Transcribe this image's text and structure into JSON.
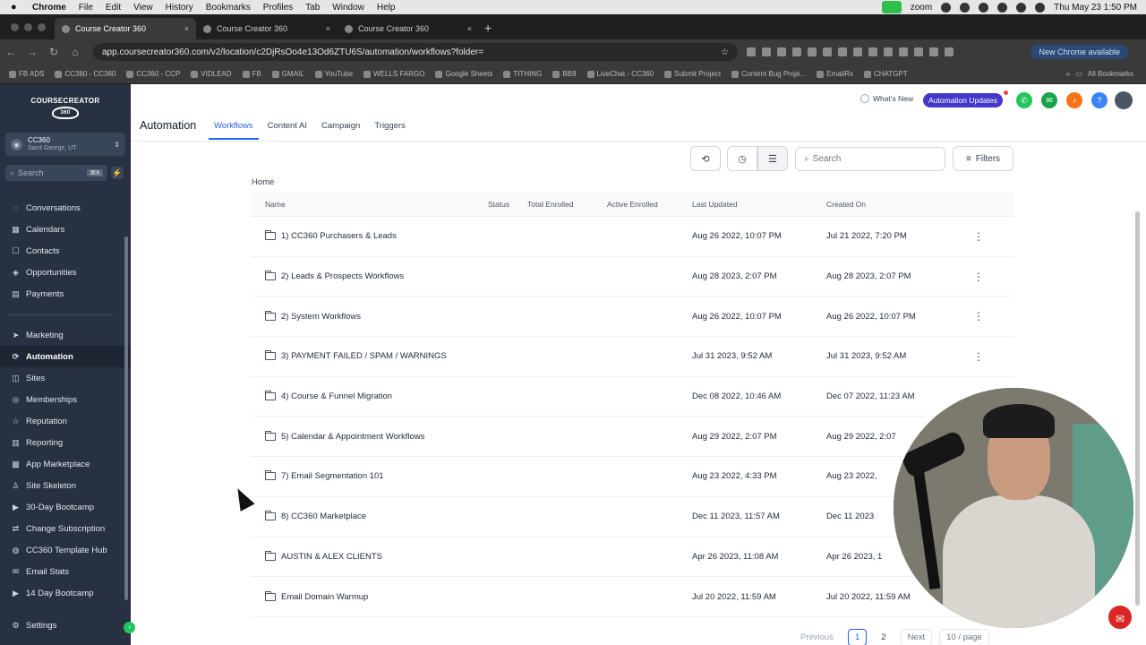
{
  "menubar": {
    "app": "Chrome",
    "items": [
      "File",
      "Edit",
      "View",
      "History",
      "Bookmarks",
      "Profiles",
      "Tab",
      "Window",
      "Help"
    ],
    "zoom": "zoom",
    "datetime": "Thu May 23  1:50 PM"
  },
  "browser": {
    "tabs": [
      {
        "label": "Course Creator 360",
        "close": "×"
      },
      {
        "label": "Course Creator 360",
        "close": "×"
      },
      {
        "label": "Course Creator 360",
        "close": "×"
      }
    ],
    "new_tab": "+",
    "url": "app.coursecreator360.com/v2/location/c2DjRsOo4e13Od6ZTU6S/automation/workflows?folder=",
    "new_chrome": "New Chrome available",
    "bookmarks": [
      "FB ADS",
      "CC360 - CC360",
      "CC360 - CCP",
      "VIDLEAD",
      "FB",
      "GMAIL",
      "YouTube",
      "WELLS FARGO",
      "Google Sheets",
      "TITHING",
      "BB9",
      "LiveChat - CC360",
      "Submit Project",
      "Content Bug Proje...",
      "EmailRx",
      "CHATGPT"
    ],
    "all_bookmarks": "All Bookmarks"
  },
  "sidebar": {
    "logo_text": "COURSECREATOR",
    "logo_mark": "360",
    "account_name": "CC360",
    "account_location": "Saint George, UT",
    "search_placeholder": "Search",
    "search_shortcut": "⌘K",
    "items_top": [
      {
        "label": "Conversations",
        "icon": "chat-icon"
      },
      {
        "label": "Calendars",
        "icon": "calendar-icon"
      },
      {
        "label": "Contacts",
        "icon": "contacts-icon"
      },
      {
        "label": "Opportunities",
        "icon": "opportunities-icon"
      },
      {
        "label": "Payments",
        "icon": "payments-icon"
      }
    ],
    "items_bottom": [
      {
        "label": "Marketing",
        "icon": "send-icon"
      },
      {
        "label": "Automation",
        "icon": "automation-icon",
        "active": true
      },
      {
        "label": "Sites",
        "icon": "sites-icon"
      },
      {
        "label": "Memberships",
        "icon": "memberships-icon"
      },
      {
        "label": "Reputation",
        "icon": "star-icon"
      },
      {
        "label": "Reporting",
        "icon": "chart-icon"
      },
      {
        "label": "App Marketplace",
        "icon": "grid-icon"
      },
      {
        "label": "Site Skeleton",
        "icon": "person-icon"
      },
      {
        "label": "30-Day Bootcamp",
        "icon": "video-icon"
      },
      {
        "label": "Change Subscription",
        "icon": "swap-icon"
      },
      {
        "label": "CC360 Template Hub",
        "icon": "hub-icon"
      },
      {
        "label": "Email Stats",
        "icon": "mail-icon"
      },
      {
        "label": "14 Day Bootcamp",
        "icon": "video-icon"
      }
    ],
    "settings": "Settings"
  },
  "header": {
    "title": "Automation",
    "tabs": [
      {
        "label": "Workflows",
        "active": true
      },
      {
        "label": "Content AI"
      },
      {
        "label": "Campaign"
      },
      {
        "label": "Triggers"
      }
    ],
    "whats_new": "What's New",
    "automation_updates": "Automation Updates",
    "help": "?"
  },
  "toolbar": {
    "search_placeholder": "Search",
    "filters": "Filters"
  },
  "breadcrumb": "Home",
  "table": {
    "columns": [
      "Name",
      "Status",
      "Total Enrolled",
      "Active Enrolled",
      "Last Updated",
      "Created On"
    ],
    "rows": [
      {
        "name": "1) CC360 Purchasers & Leads",
        "updated": "Aug 26 2022, 10:07 PM",
        "created": "Jul 21 2022, 7:20 PM"
      },
      {
        "name": "2) Leads & Prospects Workflows",
        "updated": "Aug 28 2023, 2:07 PM",
        "created": "Aug 28 2023, 2:07 PM"
      },
      {
        "name": "2) System Workflows",
        "updated": "Aug 26 2022, 10:07 PM",
        "created": "Aug 26 2022, 10:07 PM"
      },
      {
        "name": "3) PAYMENT FAILED / SPAM / WARNINGS",
        "updated": "Jul 31 2023, 9:52 AM",
        "created": "Jul 31 2023, 9:52 AM"
      },
      {
        "name": "4) Course & Funnel Migration",
        "updated": "Dec 08 2022, 10:46 AM",
        "created": "Dec 07 2022, 11:23 AM"
      },
      {
        "name": "5) Calendar & Appointment Workflows",
        "updated": "Aug 29 2022, 2:07 PM",
        "created": "Aug 29 2022, 2:07"
      },
      {
        "name": "7) Email Segmentation 101",
        "updated": "Aug 23 2022, 4:33 PM",
        "created": "Aug 23 2022,"
      },
      {
        "name": "8) CC360 Marketplace",
        "updated": "Dec 11 2023, 11:57 AM",
        "created": "Dec 11 2023"
      },
      {
        "name": "AUSTIN & ALEX CLIENTS",
        "updated": "Apr 26 2023, 11:08 AM",
        "created": "Apr 26 2023, 1"
      },
      {
        "name": "Email Domain Warmup",
        "updated": "Jul 20 2022, 11:59 AM",
        "created": "Jul 20 2022, 11:59 AM"
      }
    ],
    "menu_glyph": "⋮"
  },
  "pagination": {
    "previous": "Previous",
    "pages": [
      "1",
      "2"
    ],
    "next": "Next",
    "per_page": "10 / page"
  },
  "colors": {
    "sidebar_bg": "#273142",
    "accent_blue": "#2563eb",
    "updates_badge": "#4338ca"
  }
}
